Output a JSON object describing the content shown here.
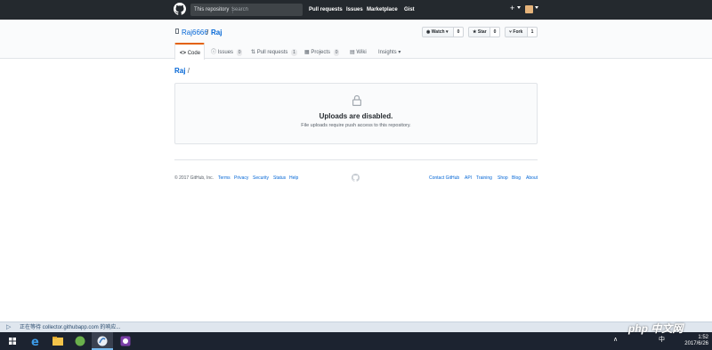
{
  "header": {
    "search_scope": "This repository",
    "search_placeholder": "Search",
    "nav": [
      "Pull requests",
      "Issues",
      "Marketplace",
      "Gist"
    ],
    "plus": "+"
  },
  "repo": {
    "owner": "Raj6666",
    "separator": "/",
    "name": "Raj",
    "watch_label": "Watch",
    "watch_count": "0",
    "star_label": "Star",
    "star_count": "0",
    "fork_label": "Fork",
    "fork_count": "1"
  },
  "tabs": {
    "code": "Code",
    "issues": "Issues",
    "issues_count": "0",
    "pulls": "Pull requests",
    "pulls_count": "1",
    "projects": "Projects",
    "projects_count": "0",
    "wiki": "Wiki",
    "insights": "Insights"
  },
  "breadcrumb": {
    "repo": "Raj",
    "separator": "/"
  },
  "blankslate": {
    "title": "Uploads are disabled.",
    "subtitle": "File uploads require push access to this repository."
  },
  "footer": {
    "copyright": "© 2017 GitHub, Inc.",
    "left_links": [
      "Terms",
      "Privacy",
      "Security",
      "Status",
      "Help"
    ],
    "right_links": [
      "Contact GitHub",
      "API",
      "Training",
      "Shop",
      "Blog",
      "About"
    ]
  },
  "statusbar": {
    "text": "正在等待 collector.githubapp.com 的响应..."
  },
  "taskbar": {
    "time": "1:52",
    "date": "2017/6/26",
    "watermark": "php 中文网"
  },
  "colors": {
    "accent": "#0366d6",
    "header_bg": "#24292e",
    "tab_active_border": "#e36209"
  }
}
